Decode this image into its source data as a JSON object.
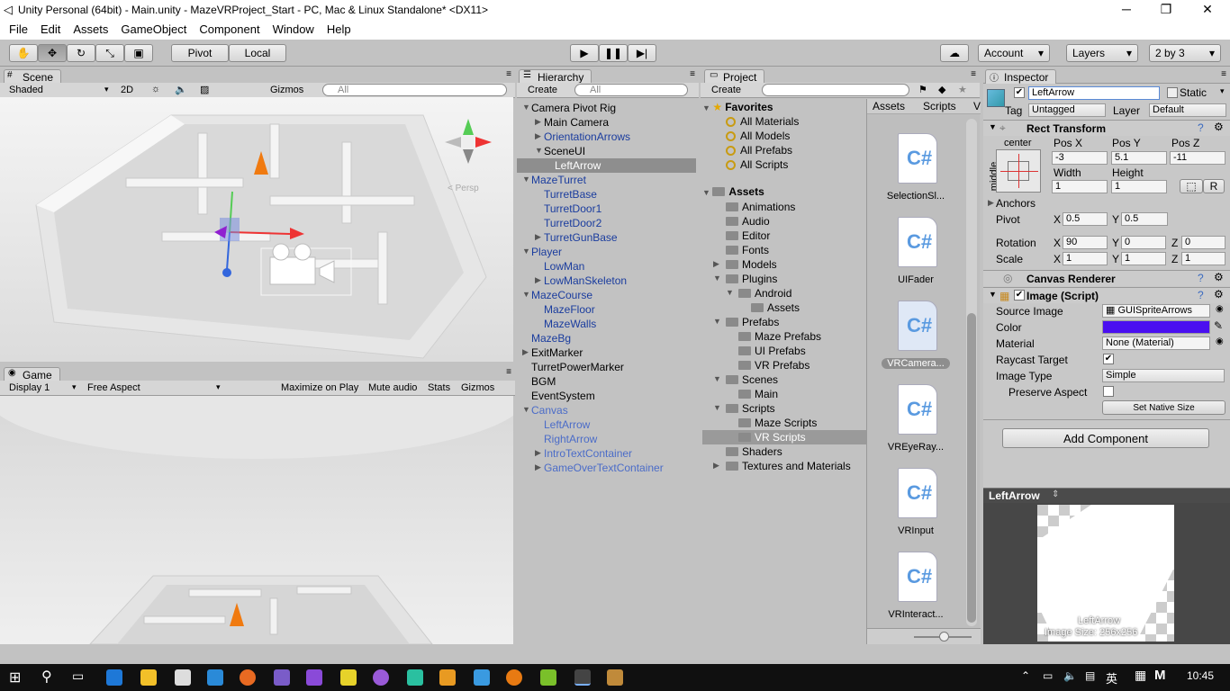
{
  "window": {
    "title": "Unity Personal (64bit) - Main.unity - MazeVRProject_Start - PC, Mac & Linux Standalone* <DX11>",
    "minimize": "─",
    "maximize": "❐",
    "close": "✕"
  },
  "menu": [
    "File",
    "Edit",
    "Assets",
    "GameObject",
    "Component",
    "Window",
    "Help"
  ],
  "toolbar": {
    "pivot": "Pivot",
    "local": "Local",
    "account": "Account",
    "layers": "Layers",
    "layout": "2 by 3",
    "cloud_icon": "cloud-icon"
  },
  "scene": {
    "tab": "Scene",
    "shading": "Shaded",
    "mode2d": "2D",
    "gizmos": "Gizmos",
    "search": "All",
    "persp": "< Persp"
  },
  "game": {
    "tab": "Game",
    "display": "Display 1",
    "aspect": "Free Aspect",
    "maximize": "Maximize on Play",
    "mute": "Mute audio",
    "stats": "Stats",
    "gizmos": "Gizmos"
  },
  "hierarchy": {
    "tab": "Hierarchy",
    "create": "Create",
    "search": "All",
    "items": [
      {
        "label": "Camera Pivot Rig",
        "indent": 0,
        "arrow": "▼",
        "style": "normal"
      },
      {
        "label": "Main Camera",
        "indent": 1,
        "arrow": "▶",
        "style": "normal"
      },
      {
        "label": "OrientationArrows",
        "indent": 1,
        "arrow": "▶",
        "style": "blue"
      },
      {
        "label": "SceneUI",
        "indent": 1,
        "arrow": "▼",
        "style": "normal"
      },
      {
        "label": "LeftArrow",
        "indent": 2,
        "arrow": "",
        "style": "sel"
      },
      {
        "label": "MazeTurret",
        "indent": 0,
        "arrow": "▼",
        "style": "blue"
      },
      {
        "label": "TurretBase",
        "indent": 1,
        "arrow": "",
        "style": "blue"
      },
      {
        "label": "TurretDoor1",
        "indent": 1,
        "arrow": "",
        "style": "blue"
      },
      {
        "label": "TurretDoor2",
        "indent": 1,
        "arrow": "",
        "style": "blue"
      },
      {
        "label": "TurretGunBase",
        "indent": 1,
        "arrow": "▶",
        "style": "blue"
      },
      {
        "label": "Player",
        "indent": 0,
        "arrow": "▼",
        "style": "blue"
      },
      {
        "label": "LowMan",
        "indent": 1,
        "arrow": "",
        "style": "blue"
      },
      {
        "label": "LowManSkeleton",
        "indent": 1,
        "arrow": "▶",
        "style": "blue"
      },
      {
        "label": "MazeCourse",
        "indent": 0,
        "arrow": "▼",
        "style": "blue"
      },
      {
        "label": "MazeFloor",
        "indent": 1,
        "arrow": "",
        "style": "blue"
      },
      {
        "label": "MazeWalls",
        "indent": 1,
        "arrow": "",
        "style": "blue"
      },
      {
        "label": "MazeBg",
        "indent": 0,
        "arrow": "",
        "style": "blue"
      },
      {
        "label": "ExitMarker",
        "indent": 0,
        "arrow": "▶",
        "style": "normal"
      },
      {
        "label": "TurretPowerMarker",
        "indent": 0,
        "arrow": "",
        "style": "normal"
      },
      {
        "label": "BGM",
        "indent": 0,
        "arrow": "",
        "style": "normal"
      },
      {
        "label": "EventSystem",
        "indent": 0,
        "arrow": "",
        "style": "normal"
      },
      {
        "label": "Canvas",
        "indent": 0,
        "arrow": "▼",
        "style": "faded"
      },
      {
        "label": "LeftArrow",
        "indent": 1,
        "arrow": "",
        "style": "faded"
      },
      {
        "label": "RightArrow",
        "indent": 1,
        "arrow": "",
        "style": "faded"
      },
      {
        "label": "IntroTextContainer",
        "indent": 1,
        "arrow": "▶",
        "style": "faded"
      },
      {
        "label": "GameOverTextContainer",
        "indent": 1,
        "arrow": "▶",
        "style": "faded"
      }
    ]
  },
  "project": {
    "tab": "Project",
    "create": "Create",
    "favorites_title": "Favorites",
    "favorites": [
      "All Materials",
      "All Models",
      "All Prefabs",
      "All Scripts"
    ],
    "assets_title": "Assets",
    "folders": [
      {
        "label": "Animations",
        "indent": 1,
        "arrow": ""
      },
      {
        "label": "Audio",
        "indent": 1,
        "arrow": ""
      },
      {
        "label": "Editor",
        "indent": 1,
        "arrow": ""
      },
      {
        "label": "Fonts",
        "indent": 1,
        "arrow": ""
      },
      {
        "label": "Models",
        "indent": 1,
        "arrow": "▶"
      },
      {
        "label": "Plugins",
        "indent": 1,
        "arrow": "▼"
      },
      {
        "label": "Android",
        "indent": 2,
        "arrow": "▼"
      },
      {
        "label": "Assets",
        "indent": 3,
        "arrow": ""
      },
      {
        "label": "Prefabs",
        "indent": 1,
        "arrow": "▼"
      },
      {
        "label": "Maze Prefabs",
        "indent": 2,
        "arrow": ""
      },
      {
        "label": "UI Prefabs",
        "indent": 2,
        "arrow": ""
      },
      {
        "label": "VR Prefabs",
        "indent": 2,
        "arrow": ""
      },
      {
        "label": "Scenes",
        "indent": 1,
        "arrow": "▼"
      },
      {
        "label": "Main",
        "indent": 2,
        "arrow": ""
      },
      {
        "label": "Scripts",
        "indent": 1,
        "arrow": "▼"
      },
      {
        "label": "Maze Scripts",
        "indent": 2,
        "arrow": ""
      },
      {
        "label": "VR Scripts",
        "indent": 2,
        "arrow": "",
        "sel": true
      },
      {
        "label": "Shaders",
        "indent": 1,
        "arrow": ""
      },
      {
        "label": "Textures and Materials",
        "indent": 1,
        "arrow": "▶"
      }
    ],
    "breadcrumb": [
      "Assets",
      "Scripts",
      "V"
    ],
    "files": [
      "SelectionSl...",
      "UIFader",
      "VRCamera...",
      "VREyeRay...",
      "VRInput",
      "VRInteract..."
    ]
  },
  "inspector": {
    "tab": "Inspector",
    "name": "LeftArrow",
    "static": "Static",
    "tag_label": "Tag",
    "tag": "Untagged",
    "layer_label": "Layer",
    "layer": "Default",
    "rect_title": "Rect Transform",
    "anchor_h": "center",
    "anchor_v": "middle",
    "posx_l": "Pos X",
    "posy_l": "Pos Y",
    "posz_l": "Pos Z",
    "posx": "-3",
    "posy": "5.1",
    "posz": "-11",
    "w_l": "Width",
    "h_l": "Height",
    "w": "1",
    "h": "1",
    "r_btn": "R",
    "anchors": "Anchors",
    "pivot_l": "Pivot",
    "pivot_x": "0.5",
    "pivot_y": "0.5",
    "rotation_l": "Rotation",
    "rot_x": "90",
    "rot_y": "0",
    "rot_z": "0",
    "scale_l": "Scale",
    "sc_x": "1",
    "sc_y": "1",
    "sc_z": "1",
    "x": "X",
    "y": "Y",
    "z": "Z",
    "canvas_renderer": "Canvas Renderer",
    "image_script": "Image (Script)",
    "source_l": "Source Image",
    "source": "GUISpriteArrows",
    "color_l": "Color",
    "color": "#4a0ff0",
    "material_l": "Material",
    "material": "None (Material)",
    "raycast_l": "Raycast Target",
    "imgtype_l": "Image Type",
    "imgtype": "Simple",
    "preserve_l": "Preserve Aspect",
    "native_btn": "Set Native Size",
    "add_component": "Add Component",
    "preview_title": "LeftArrow",
    "preview_caption1": "LeftArrow",
    "preview_caption2": "Image Size: 256x256"
  },
  "taskbar": {
    "ime": "英",
    "time": "10:45",
    "m": "M"
  }
}
